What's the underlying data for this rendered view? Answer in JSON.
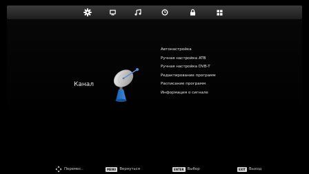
{
  "tabs": [
    {
      "icon": "gear-icon",
      "active": true
    },
    {
      "icon": "tv-icon",
      "active": false
    },
    {
      "icon": "music-icon",
      "active": false
    },
    {
      "icon": "clock-icon",
      "active": false
    },
    {
      "icon": "lock-icon",
      "active": false
    },
    {
      "icon": "grid-icon",
      "active": false
    }
  ],
  "category": {
    "label": "Канал",
    "icon": "satellite-dish-icon"
  },
  "menu": {
    "items": [
      {
        "label": "Автонастройка"
      },
      {
        "label": "Ручная настройка ATB"
      },
      {
        "label": "Ручная настройка DVB-T"
      },
      {
        "label": "Редактирование программ"
      },
      {
        "label": "Расписание программ"
      },
      {
        "label": "Информация о сигнале"
      }
    ]
  },
  "footer": {
    "move": {
      "label": "Перемес..",
      "icon": "dpad-arrows-icon"
    },
    "menu": {
      "key": "MENU",
      "label": "Вернуться"
    },
    "enter": {
      "key": "ENTER",
      "label": "Выбор"
    },
    "exit": {
      "key": "EXIT",
      "label": "Выход"
    }
  },
  "colors": {
    "background": "#000000",
    "top_bar": "#2c2c2c",
    "text": "#e6e6e6",
    "key_badge": "#d8d8d8"
  }
}
